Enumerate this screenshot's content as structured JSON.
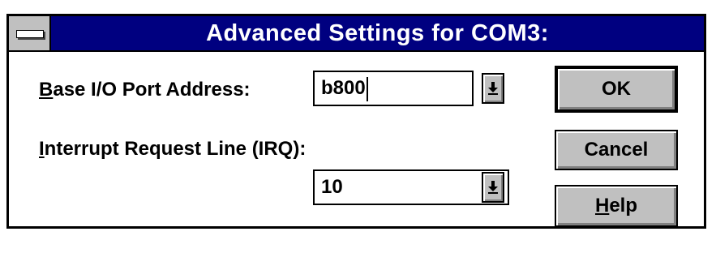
{
  "dialog": {
    "title": "Advanced Settings for COM3:",
    "base_io": {
      "label_accel": "B",
      "label_rest": "ase I/O Port Address:",
      "value": "b800"
    },
    "irq": {
      "label_accel": "I",
      "label_rest": "nterrupt Request Line (IRQ):",
      "value": "10"
    },
    "buttons": {
      "ok": "OK",
      "cancel": "Cancel",
      "help_accel": "H",
      "help_rest": "elp"
    }
  },
  "icons": [
    "system-menu-icon",
    "dropdown-arrow-icon"
  ],
  "colors": {
    "titlebar": "#000080",
    "button_face": "#c0c0c0"
  }
}
